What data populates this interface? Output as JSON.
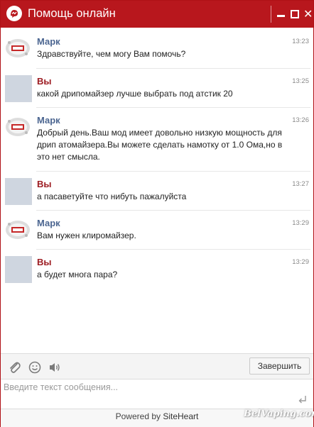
{
  "window": {
    "title": "Помощь онлайн",
    "accent_color": "#b8171d"
  },
  "window_controls": {
    "minimize_icon": "minimize-icon",
    "maximize_icon": "maximize-icon",
    "close_icon": "close-icon"
  },
  "messages": [
    {
      "role": "operator",
      "sender": "Марк",
      "time": "13:23",
      "text": "Здравствуйте, чем могу Вам помочь?"
    },
    {
      "role": "user",
      "sender": "Вы",
      "time": "13:25",
      "text": "какой дрипомайзер лучше выбрать под атстик 20"
    },
    {
      "role": "operator",
      "sender": "Марк",
      "time": "13:26",
      "text": "Добрый день.Ваш мод имеет довольно низкую мощность для дрип атомайзера.Вы можете сделать намотку от 1.0 Ома,но в это нет смысла."
    },
    {
      "role": "user",
      "sender": "Вы",
      "time": "13:27",
      "text": "а пасаветуйте что нибуть пажалуйста"
    },
    {
      "role": "operator",
      "sender": "Марк",
      "time": "13:29",
      "text": "Вам нужен клиромайзер."
    },
    {
      "role": "user",
      "sender": "Вы",
      "time": "13:29",
      "text": "а будет многа пара?"
    }
  ],
  "toolbar": {
    "finish_label": "Завершить",
    "icons": [
      "paperclip-icon",
      "smiley-icon",
      "speaker-icon"
    ]
  },
  "input": {
    "placeholder": "Введите текст сообщения..."
  },
  "footer": {
    "powered_by": "Powered by ",
    "brand": "SiteHeart"
  },
  "watermark": "BelVaping.com",
  "colors": {
    "operator_name": "#4c6691",
    "user_name": "#9d1c22",
    "header": "#b8171d"
  }
}
